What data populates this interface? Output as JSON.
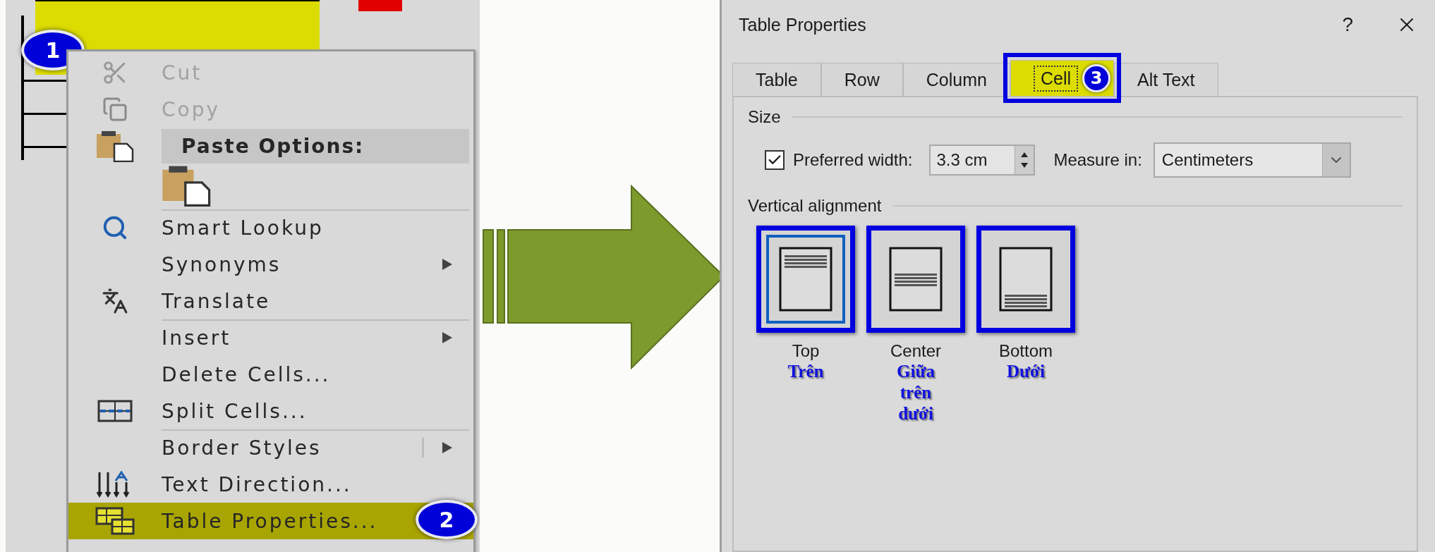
{
  "document": {
    "step": "1"
  },
  "context_menu": {
    "items": [
      {
        "kind": "cut",
        "label": "Cut",
        "disabled": true,
        "submenu": false,
        "highlighted": false,
        "divider_above": false
      },
      {
        "kind": "copy",
        "label": "Copy",
        "disabled": true,
        "submenu": false,
        "highlighted": false,
        "divider_above": false
      },
      {
        "kind": "paste-header",
        "label": "Paste Options:",
        "disabled": false,
        "submenu": false,
        "highlighted": false,
        "divider_above": false
      },
      {
        "kind": "paste-option",
        "submenu": false,
        "highlighted": false,
        "divider_above": false
      },
      {
        "kind": "smart-lookup",
        "label": "Smart Lookup",
        "disabled": false,
        "submenu": false,
        "highlighted": false,
        "divider_above": true
      },
      {
        "kind": "plain",
        "label": "Synonyms",
        "disabled": false,
        "submenu": true,
        "highlighted": false,
        "divider_above": false
      },
      {
        "kind": "translate",
        "label": "Translate",
        "disabled": false,
        "submenu": false,
        "highlighted": false,
        "divider_above": false
      },
      {
        "kind": "plain",
        "label": "Insert",
        "disabled": false,
        "submenu": true,
        "highlighted": false,
        "divider_above": true
      },
      {
        "kind": "plain",
        "label": "Delete Cells...",
        "disabled": false,
        "submenu": false,
        "highlighted": false,
        "divider_above": false
      },
      {
        "kind": "split-cells",
        "label": "Split Cells...",
        "disabled": false,
        "submenu": false,
        "highlighted": false,
        "divider_above": false
      },
      {
        "kind": "border-styles",
        "label": "Border Styles",
        "disabled": false,
        "submenu": true,
        "highlighted": false,
        "divider_above": true
      },
      {
        "kind": "text-direction",
        "label": "Text Direction...",
        "disabled": false,
        "submenu": false,
        "highlighted": false,
        "divider_above": false
      },
      {
        "kind": "table-properties",
        "label": "Table Properties...",
        "disabled": false,
        "submenu": false,
        "highlighted": true,
        "divider_above": false,
        "step": "2"
      }
    ]
  },
  "dialog": {
    "title": "Table Properties",
    "help": "?",
    "tabs": [
      {
        "label": "Table",
        "selected": false
      },
      {
        "label": "Row",
        "selected": false
      },
      {
        "label": "Column",
        "selected": false
      },
      {
        "label": "Cell",
        "selected": true,
        "step": "3"
      },
      {
        "label": "Alt Text",
        "selected": false
      }
    ],
    "size": {
      "heading": "Size",
      "preferred_width": {
        "label": "Preferred width:",
        "checked": true,
        "value": "3.3 cm"
      },
      "measure_in": {
        "label": "Measure in:",
        "value": "Centimeters"
      }
    },
    "vertical_alignment": {
      "heading": "Vertical alignment",
      "options": [
        {
          "kind": "top",
          "label": "Top",
          "note": "Trên",
          "selected": true
        },
        {
          "kind": "center",
          "label": "Center",
          "note": "Giữa trên dưới",
          "selected": false
        },
        {
          "kind": "bottom",
          "label": "Bottom",
          "note": "Dưới",
          "selected": false
        }
      ]
    }
  }
}
